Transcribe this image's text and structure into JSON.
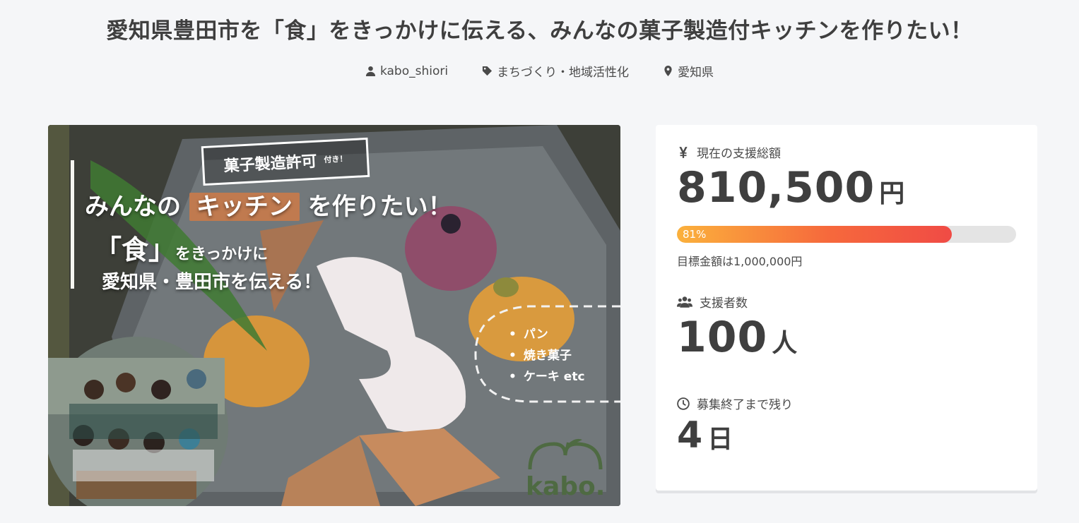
{
  "project": {
    "title": "愛知県豊田市を「食」をきっかけに伝える、みんなの菓子製造付キッチンを作りたい！",
    "author": "kabo_shiori",
    "category": "まちづくり・地域活性化",
    "location": "愛知県",
    "icons": {
      "author": "user-icon",
      "category": "tag-icon",
      "location": "map-pin-icon"
    }
  },
  "hero": {
    "badge_main": "菓子製造許可",
    "badge_small": "付き！",
    "line1_pre": "みんなの",
    "line1_highlight": "キッチン",
    "line1_post": "を作りたい！",
    "line2_big": "「食」",
    "line2_small": "をきっかけに",
    "line3": "愛知県・豊田市を伝える！",
    "list": [
      "パン",
      "焼き菓子",
      "ケーキ etc"
    ],
    "logo_text": "kabo."
  },
  "stats": {
    "amount_label": "現在の支援総額",
    "amount": "810,500",
    "amount_unit": "円",
    "progress_percent": 81,
    "progress_label": "81%",
    "goal_text": "目標金額は1,000,000円",
    "backers_label": "支援者数",
    "backers": "100",
    "backers_unit": "人",
    "remaining_label": "募集終了まで残り",
    "remaining": "4",
    "remaining_unit": "日",
    "icons": {
      "amount": "yen-icon",
      "backers": "users-icon",
      "remaining": "clock-icon"
    }
  },
  "colors": {
    "progress_start": "#fbb13c",
    "progress_end": "#f04b45",
    "background": "#f5f6f8",
    "card": "#ffffff"
  }
}
